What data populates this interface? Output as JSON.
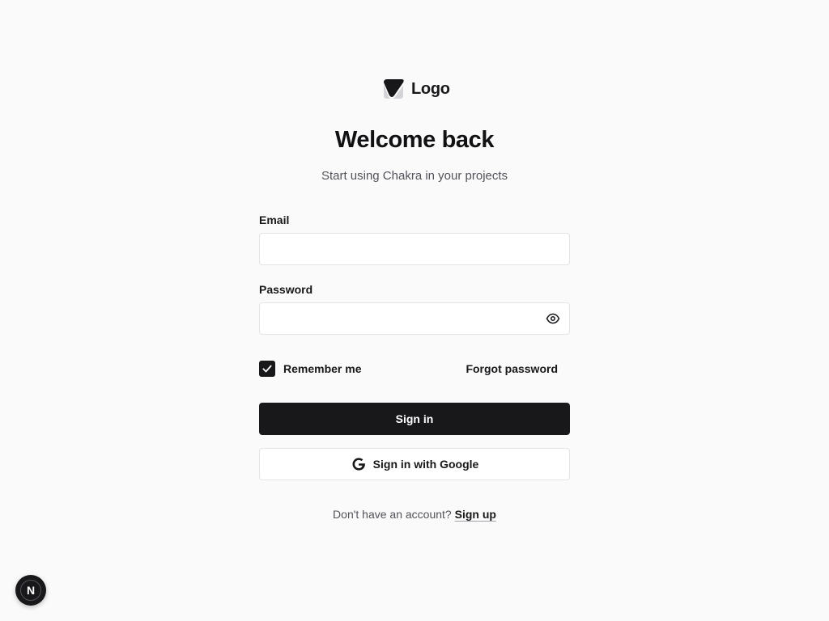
{
  "logo": {
    "text": "Logo",
    "icon": "logo-mark-icon"
  },
  "heading": {
    "title": "Welcome back",
    "subtitle": "Start using Chakra in your projects"
  },
  "form": {
    "email_label": "Email",
    "email_value": "",
    "password_label": "Password",
    "password_value": "",
    "password_toggle_icon": "eye-icon",
    "remember_label": "Remember me",
    "remember_checked": true,
    "forgot_label": "Forgot password",
    "signin_label": "Sign in",
    "google_label": "Sign in with Google",
    "google_icon": "google-icon"
  },
  "footer": {
    "prompt": "Don't have an account?",
    "signup_label": "Sign up"
  },
  "dev_badge": {
    "text": "N",
    "icon": "nextjs-icon"
  },
  "colors": {
    "primary": "#18181b",
    "border": "#e4e4e7",
    "muted": "#52525b",
    "background": "#fafafa"
  }
}
